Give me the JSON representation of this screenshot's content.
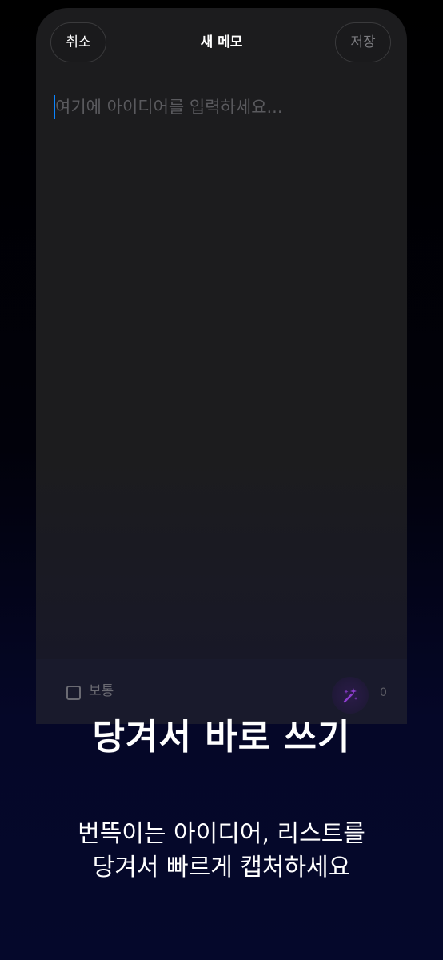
{
  "header": {
    "cancel_label": "취소",
    "title": "새 메모",
    "save_label": "저장"
  },
  "editor": {
    "placeholder": "여기에 아이디어를 입력하세요..."
  },
  "bottom_bar": {
    "priority_label": "보통",
    "character_count": "0",
    "magic_icon": "magic-wand-icon"
  },
  "promo": {
    "headline": "당겨서 바로 쓰기",
    "subtitle_line1": "번뜩이는 아이디어, 리스트를",
    "subtitle_line2": "당겨서 빠르게 캡처하세요"
  },
  "colors": {
    "accent_caret": "#0a84ff",
    "magic_icon": "#8e3dcf",
    "panel": "#1c1c1e"
  }
}
